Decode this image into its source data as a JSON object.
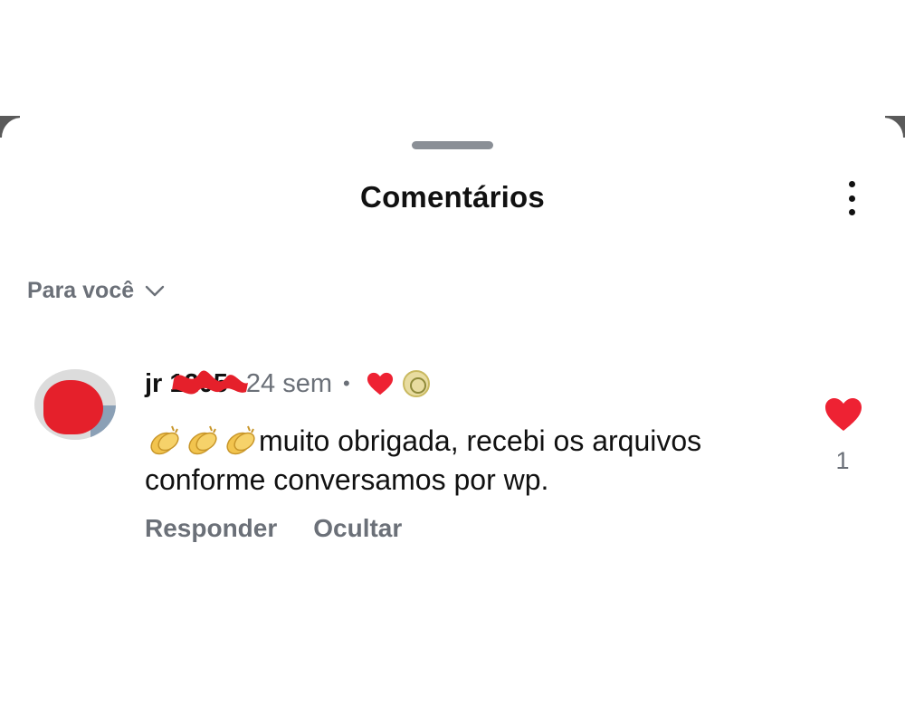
{
  "sheet": {
    "title": "Comentários",
    "more_icon": "more-vertical-icon"
  },
  "sort": {
    "label": "Para você",
    "icon": "chevron-down-icon"
  },
  "comment": {
    "username": "jr 1205",
    "timestamp": "24 sem",
    "separator": "•",
    "liked_by_creator": true,
    "text": "muito obrigada, recebi os arquivos conforme conversamos por wp.",
    "emoji_prefix": [
      "clap-icon",
      "clap-icon",
      "clap-icon"
    ],
    "actions": {
      "reply": "Responder",
      "hide": "Ocultar"
    },
    "like_count": "1"
  },
  "colors": {
    "heart": "#ee2233",
    "muted_text": "#6b7078",
    "primary_text": "#111111",
    "redaction": "#e5202b"
  }
}
